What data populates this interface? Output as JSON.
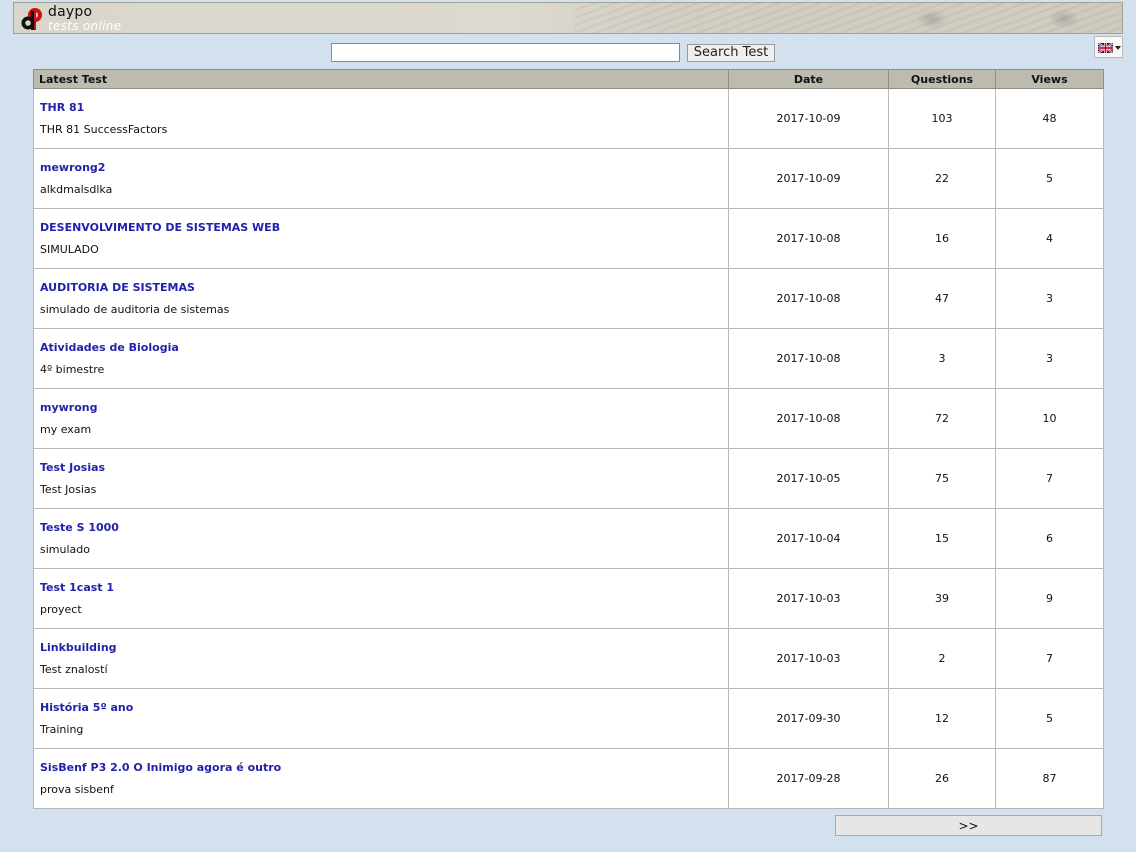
{
  "header": {
    "logo_title": "daypo",
    "logo_subtitle": "tests online"
  },
  "search": {
    "value": "",
    "button_label": "Search Test"
  },
  "language": {
    "selected_icon": "uk-flag-icon"
  },
  "table": {
    "headers": {
      "latest": "Latest Test",
      "date": "Date",
      "questions": "Questions",
      "views": "Views"
    },
    "rows": [
      {
        "title": "THR 81",
        "desc": "THR 81 SuccessFactors",
        "date": "2017-10-09",
        "questions": "103",
        "views": "48"
      },
      {
        "title": "mewrong2",
        "desc": "alkdmalsdlka",
        "date": "2017-10-09",
        "questions": "22",
        "views": "5"
      },
      {
        "title": "DESENVOLVIMENTO DE SISTEMAS WEB",
        "desc": "SIMULADO",
        "date": "2017-10-08",
        "questions": "16",
        "views": "4"
      },
      {
        "title": "AUDITORIA DE SISTEMAS",
        "desc": "simulado de auditoria de sistemas",
        "date": "2017-10-08",
        "questions": "47",
        "views": "3"
      },
      {
        "title": "Atividades de Biologia",
        "desc": "4º bimestre",
        "date": "2017-10-08",
        "questions": "3",
        "views": "3"
      },
      {
        "title": "mywrong",
        "desc": "my exam",
        "date": "2017-10-08",
        "questions": "72",
        "views": "10"
      },
      {
        "title": "Test Josias",
        "desc": "Test Josias",
        "date": "2017-10-05",
        "questions": "75",
        "views": "7"
      },
      {
        "title": "Teste S 1000",
        "desc": "simulado",
        "date": "2017-10-04",
        "questions": "15",
        "views": "6"
      },
      {
        "title": "Test 1cast 1",
        "desc": "proyect",
        "date": "2017-10-03",
        "questions": "39",
        "views": "9"
      },
      {
        "title": "Linkbuilding",
        "desc": "Test znalostí",
        "date": "2017-10-03",
        "questions": "2",
        "views": "7"
      },
      {
        "title": "História 5º ano",
        "desc": "Training",
        "date": "2017-09-30",
        "questions": "12",
        "views": "5"
      },
      {
        "title": "SisBenf P3 2.0 O Inimigo agora é outro",
        "desc": "prova sisbenf",
        "date": "2017-09-28",
        "questions": "26",
        "views": "87"
      }
    ]
  },
  "pagination": {
    "next_label": ">>"
  },
  "colors": {
    "page_background": "#d3e0ee",
    "header_background": "#bdbaaf",
    "link": "#2222aa",
    "logo_red": "#cc1111"
  }
}
